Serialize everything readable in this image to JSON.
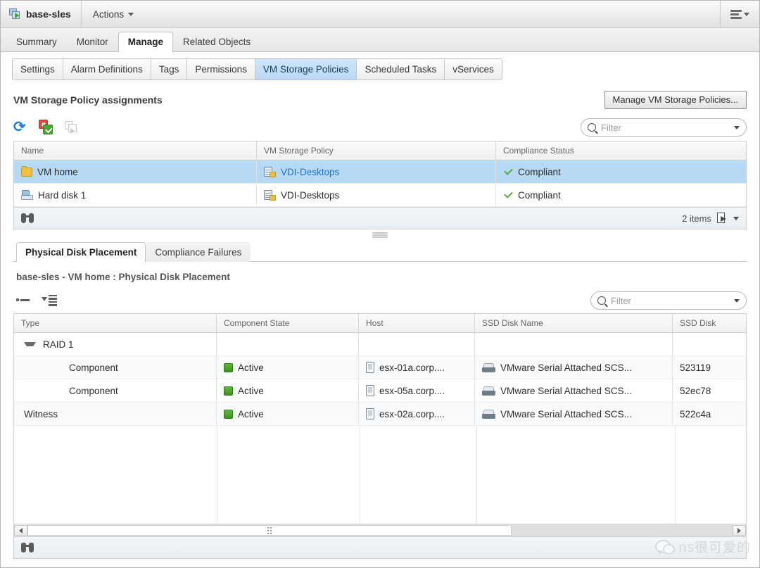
{
  "object_bar": {
    "object_name": "base-sles",
    "object_icon": "virtual-machine-icon",
    "actions_label": "Actions",
    "menu_icon": "filter-sort-menu-icon"
  },
  "primary_tabs": [
    {
      "label": "Summary",
      "selected": false
    },
    {
      "label": "Monitor",
      "selected": false
    },
    {
      "label": "Manage",
      "selected": true
    },
    {
      "label": "Related Objects",
      "selected": false
    }
  ],
  "secondary_tabs": [
    {
      "label": "Settings",
      "selected": false
    },
    {
      "label": "Alarm Definitions",
      "selected": false
    },
    {
      "label": "Tags",
      "selected": false
    },
    {
      "label": "Permissions",
      "selected": false
    },
    {
      "label": "VM Storage Policies",
      "selected": true
    },
    {
      "label": "Scheduled Tasks",
      "selected": false
    },
    {
      "label": "vServices",
      "selected": false
    }
  ],
  "upper_panel": {
    "title": "VM Storage Policy assignments",
    "manage_button": "Manage VM Storage Policies...",
    "toolbar": {
      "refresh_icon": "refresh-icon",
      "check_compliance_icon": "check-compliance-icon",
      "edit_assignment_icon": "edit-vm-storage-policies-icon"
    },
    "filter": {
      "placeholder": "Filter",
      "value": "",
      "search_icon": "search-icon",
      "dropdown_icon": "chevron-down-icon"
    },
    "columns": [
      "Name",
      "VM Storage Policy",
      "Compliance Status"
    ],
    "rows": [
      {
        "name": "VM home",
        "name_icon": "folder-icon",
        "policy": "VDI-Desktops",
        "policy_icon": "storage-policy-icon",
        "status": "Compliant",
        "status_icon": "green-check-icon",
        "selected": true
      },
      {
        "name": "Hard disk 1",
        "name_icon": "hard-disk-icon",
        "policy": "VDI-Desktops",
        "policy_icon": "storage-policy-icon",
        "status": "Compliant",
        "status_icon": "green-check-icon",
        "selected": false
      }
    ],
    "footer": {
      "find_icon": "binoculars-icon",
      "item_count": "2 items",
      "export_icon": "export-icon",
      "export_caret": "chevron-down-icon"
    }
  },
  "lower_panel": {
    "tabs": [
      {
        "label": "Physical Disk Placement",
        "selected": true
      },
      {
        "label": "Compliance Failures",
        "selected": false
      }
    ],
    "breadcrumb": "base-sles - VM home : Physical Disk Placement",
    "toolbar": {
      "collapse_all_icon": "collapse-all-icon",
      "expand_all_icon": "expand-all-icon"
    },
    "filter": {
      "placeholder": "Filter",
      "value": "",
      "search_icon": "search-icon",
      "dropdown_icon": "chevron-down-icon"
    },
    "columns": [
      "Type",
      "Component State",
      "Host",
      "SSD Disk Name",
      "SSD Disk"
    ],
    "rows": [
      {
        "type": "RAID 1",
        "is_group": true,
        "expanded": true,
        "state": "",
        "host": "",
        "ssd_disk_name": "",
        "ssd_disk": ""
      },
      {
        "type": "Component",
        "is_group": false,
        "indent": true,
        "state": "Active",
        "state_icon": "green-square-icon",
        "host": "esx-01a.corp....",
        "host_icon": "host-icon",
        "ssd_disk_name": "VMware Serial Attached SCS...",
        "ssd_disk_icon": "ssd-disk-icon",
        "ssd_disk": "523119"
      },
      {
        "type": "Component",
        "is_group": false,
        "indent": true,
        "state": "Active",
        "state_icon": "green-square-icon",
        "host": "esx-05a.corp....",
        "host_icon": "host-icon",
        "ssd_disk_name": "VMware Serial Attached SCS...",
        "ssd_disk_icon": "ssd-disk-icon",
        "ssd_disk": "52ec78"
      },
      {
        "type": "Witness",
        "is_group": false,
        "indent": false,
        "state": "Active",
        "state_icon": "green-square-icon",
        "host": "esx-02a.corp....",
        "host_icon": "host-icon",
        "ssd_disk_name": "VMware Serial Attached SCS...",
        "ssd_disk_icon": "ssd-disk-icon",
        "ssd_disk": "522c4a"
      }
    ],
    "hscroll": {
      "left_arrow_icon": "scroll-left-icon",
      "right_arrow_icon": "scroll-right-icon"
    },
    "footer": {
      "find_icon": "binoculars-icon"
    }
  },
  "watermark": {
    "text": "ns很可爱的",
    "logo_icon": "wechat-icon"
  },
  "colors": {
    "selected_row": "#b6d9f4",
    "selected_tab": "#b9d9f8",
    "link": "#1f6fd0",
    "compliant_green": "#5aa93a",
    "active_green": "#3f8f22",
    "refresh_blue": "#1f7fd0"
  }
}
